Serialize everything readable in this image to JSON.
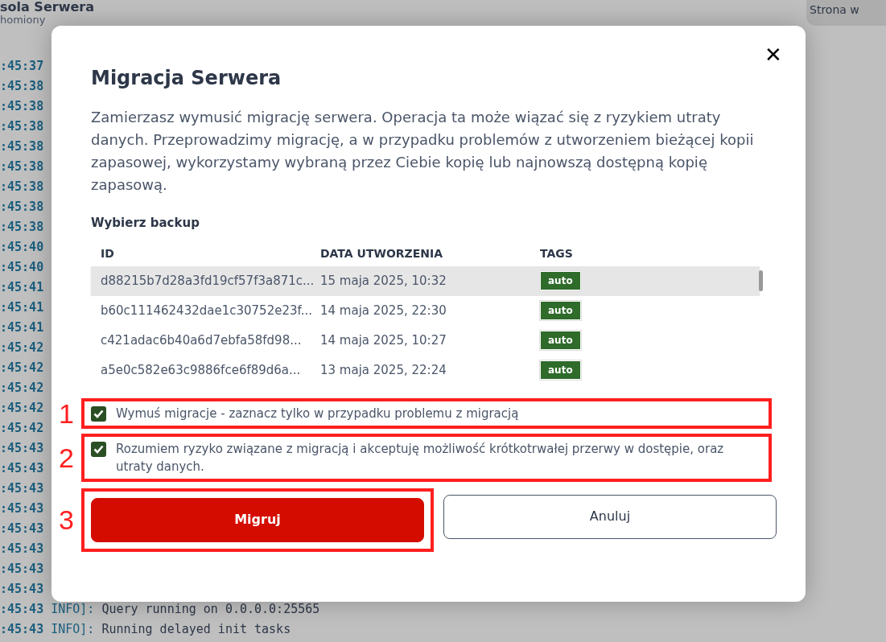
{
  "page": {
    "title": "sola Serwera",
    "status": "homiony",
    "side_card": "Strona w"
  },
  "console": [
    {
      "time": ":45:37"
    },
    {
      "time": ":45:38"
    },
    {
      "time": ":45:38"
    },
    {
      "time": ":45:38"
    },
    {
      "time": ":45:38"
    },
    {
      "time": ":45:38"
    },
    {
      "time": ":45:38"
    },
    {
      "time": ":45:38"
    },
    {
      "time": ":45:38"
    },
    {
      "time": ":45:40"
    },
    {
      "time": ":45:40"
    },
    {
      "time": ":45:41"
    },
    {
      "time": ":45:41"
    },
    {
      "time": ":45:41"
    },
    {
      "time": ":45:42"
    },
    {
      "time": ":45:42"
    },
    {
      "time": ":45:42"
    },
    {
      "time": ":45:42"
    },
    {
      "time": ":45:42"
    },
    {
      "time": ":45:43"
    },
    {
      "time": ":45:43"
    },
    {
      "time": ":45:43"
    },
    {
      "time": ":45:43"
    },
    {
      "time": ":45:43"
    },
    {
      "time": ":45:43"
    },
    {
      "time": ":45:43"
    },
    {
      "time": ":45:43"
    },
    {
      "time": ":45:43",
      "level": "INFO]:",
      "message": "Query running on 0.0.0.0:25565"
    },
    {
      "time": ":45:43",
      "level": "INFO]:",
      "message": "Running delayed init tasks"
    }
  ],
  "dialog": {
    "title": "Migracja Serwera",
    "close": "✕",
    "description": "Zamierzasz wymusić migrację serwera. Operacja ta może wiązać się z ryzykiem utraty danych. Przeprowadzimy migrację, a w przypadku problemów z utworzeniem bieżącej kopii zapasowej, wykorzystamy wybraną przez Ciebie kopię lub najnowszą dostępną kopię zapasową.",
    "backup_label": "Wybierz backup",
    "table": {
      "columns": [
        "ID",
        "DATA UTWORZENIA",
        "TAGS"
      ],
      "rows": [
        {
          "id": "d88215b7d28a3fd19cf57f3a871c...",
          "created": "15 maja 2025, 10:32",
          "tags": [
            "auto"
          ],
          "selected": true
        },
        {
          "id": "b60c111462432dae1c30752e23f...",
          "created": "14 maja 2025, 22:30",
          "tags": [
            "auto"
          ],
          "selected": false
        },
        {
          "id": "c421adac6b40a6d7ebfa58fd98...",
          "created": "14 maja 2025, 10:27",
          "tags": [
            "auto"
          ],
          "selected": false
        },
        {
          "id": "a5e0c582e63c9886fce6f89d6a...",
          "created": "13 maja 2025, 22:24",
          "tags": [
            "auto"
          ],
          "selected": false
        }
      ]
    },
    "checkboxes": [
      {
        "label": "Wymuś migracje - zaznacz tylko w przypadku problemu z migracją",
        "checked": true,
        "annotation": "1"
      },
      {
        "label": "Rozumiem ryzyko związane z migracją i akceptuję możliwość krótkotrwałej przerwy w dostępie, oraz utraty danych.",
        "checked": true,
        "annotation": "2"
      }
    ],
    "buttons": [
      {
        "label": "Migruj",
        "kind": "primary",
        "annotation": "3"
      },
      {
        "label": "Anuluj",
        "kind": "secondary"
      }
    ]
  }
}
